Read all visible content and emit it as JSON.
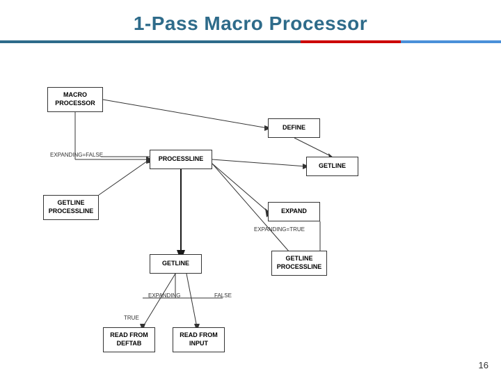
{
  "title": "1-Pass Macro Processor",
  "page_number": "16",
  "boxes": {
    "macro_processor": "MACRO\nPROCESSOR",
    "processline": "PROCESSLINE",
    "getline_processline_left": "GETLINE\nPROCESSLINE",
    "getline": "GETLINE",
    "define": "DEFINE",
    "getline_right": "GETLINE",
    "expand": "EXPAND",
    "getline_processline_right": "GETLINE\nPROCESSLINE",
    "read_from_deftab": "READ FROM\nDEFTAB",
    "read_from_input": "READ FROM\nINPUT"
  },
  "labels": {
    "expanding_false": "EXPANDING=FALSE",
    "expanding_true": "EXPANDING=TRUE",
    "expanding": "EXPANDING",
    "true": "TRUE",
    "false": "FALSE"
  }
}
